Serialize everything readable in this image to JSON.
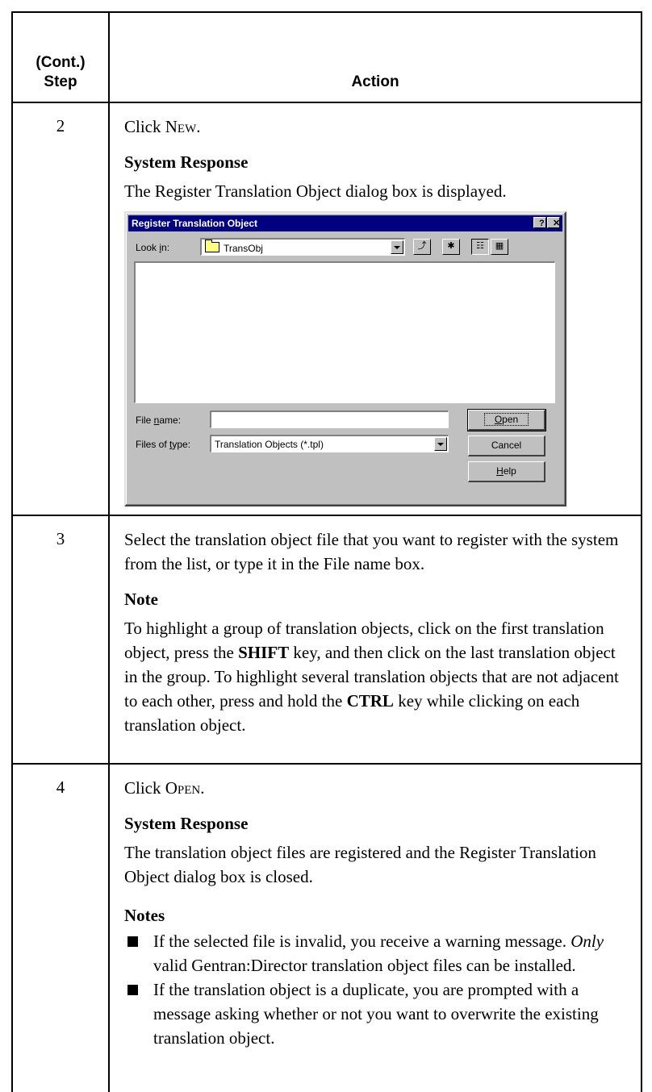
{
  "table": {
    "header_step": "(Cont.)\nStep",
    "header_action": "Action"
  },
  "rows": [
    {
      "step": "2",
      "click_prefix": "Click ",
      "click_target": "New",
      "click_suffix": ".",
      "sub_heading": "System Response",
      "response": "The Register Translation Object dialog box is displayed."
    },
    {
      "step": "3",
      "text": "Select the translation object file that you want to register with the system from the list, or type it in the File name box.",
      "note_heading": "Note",
      "note_parts": [
        "To highlight a group of translation objects, click on the first translation object, press the ",
        "SHIFT",
        " key, and then click on the last translation object in the group. To highlight several translation objects that are not adjacent to each other, press and hold the ",
        "CTRL",
        " key while clicking on each translation object."
      ]
    },
    {
      "step": "4",
      "click_prefix": "Click ",
      "click_target": "Open",
      "click_suffix": ".",
      "sub_heading": "System Response",
      "response": "The translation object files are registered and the Register Translation Object dialog box is closed.",
      "notes_heading": "Notes",
      "notes": [
        {
          "pre": "If the selected file is invalid, you receive a warning message. ",
          "em": "Only",
          "post": " valid Gentran:Director translation object files can be installed."
        },
        {
          "text": "If the translation object is a duplicate, you are prompted with a message asking whether or not you want to overwrite the existing translation object."
        }
      ]
    }
  ],
  "dialog": {
    "title": "Register Translation Object",
    "help_glyph": "?",
    "close_glyph": "✕",
    "look_in_label": "Look in:",
    "look_in_label_pre": "Look ",
    "look_in_label_key": "i",
    "look_in_label_post": "n:",
    "look_in_value": "TransObj",
    "file_name_label_pre": "File ",
    "file_name_label_key": "n",
    "file_name_label_post": "ame:",
    "file_name_value": "",
    "files_of_type_label_pre": "Files of ",
    "files_of_type_label_key": "t",
    "files_of_type_label_post": "ype:",
    "files_of_type_value": "Translation Objects (*.tpl)",
    "open_button_key": "O",
    "open_button_rest": "pen",
    "cancel_button": "Cancel",
    "help_button_key": "H",
    "help_button_rest": "elp",
    "icon_colors": {
      "folder": "#ffff80",
      "titlebar": "#000080",
      "face": "#c0c0c0"
    }
  }
}
